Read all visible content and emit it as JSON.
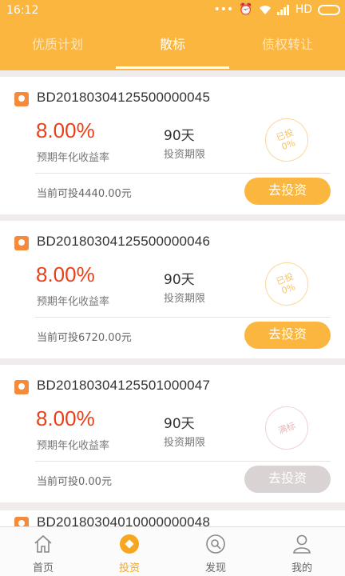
{
  "status_bar": {
    "time": "16:12",
    "network": "HD"
  },
  "tabs": [
    {
      "label": "优质计划",
      "active": false
    },
    {
      "label": "散标",
      "active": true
    },
    {
      "label": "债权转让",
      "active": false
    }
  ],
  "loans": [
    {
      "id": "BD20180304125500000045",
      "rate": "8.00%",
      "rate_label": "预期年化收益率",
      "term": "90天",
      "term_label": "投资期限",
      "stamp_line1": "已投",
      "stamp_line2": "0%",
      "available": "当前可投4440.00元",
      "button": "去投资",
      "full": false
    },
    {
      "id": "BD20180304125500000046",
      "rate": "8.00%",
      "rate_label": "预期年化收益率",
      "term": "90天",
      "term_label": "投资期限",
      "stamp_line1": "已投",
      "stamp_line2": "0%",
      "available": "当前可投6720.00元",
      "button": "去投资",
      "full": false
    },
    {
      "id": "BD20180304125501000047",
      "rate": "8.00%",
      "rate_label": "预期年化收益率",
      "term": "90天",
      "term_label": "投资期限",
      "stamp_line1": "满标",
      "stamp_line2": "",
      "available": "当前可投0.00元",
      "button": "去投资",
      "full": true
    }
  ],
  "partial_loan": {
    "id": "BD20180304010000000048"
  },
  "bottom_nav": [
    {
      "label": "首页",
      "icon": "home-icon",
      "active": false
    },
    {
      "label": "投资",
      "icon": "invest-icon",
      "active": true
    },
    {
      "label": "发现",
      "icon": "discover-icon",
      "active": false
    },
    {
      "label": "我的",
      "icon": "profile-icon",
      "active": false
    }
  ],
  "colors": {
    "primary": "#fbb640",
    "rate": "#e8411a",
    "active_nav": "#f6a71f",
    "disabled": "#d9d3d3"
  }
}
